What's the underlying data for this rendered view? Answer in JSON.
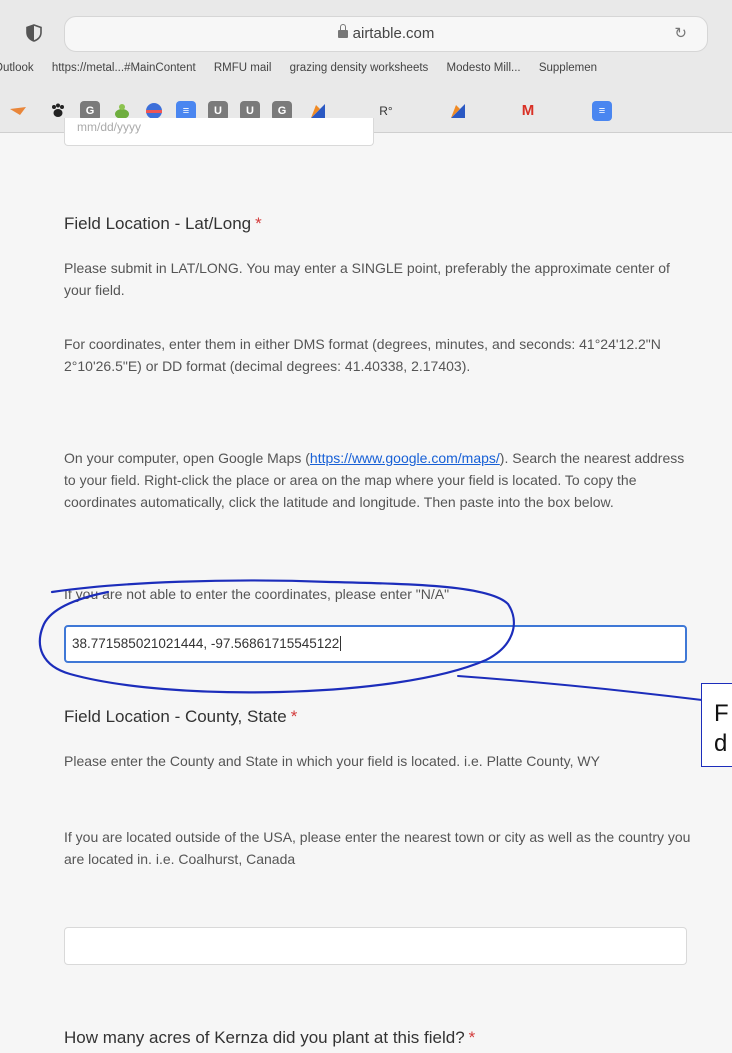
{
  "browser": {
    "url": "airtable.com",
    "bookmarks": [
      "Outlook",
      "https://metal...#MainContent",
      "RMFU mail",
      "grazing density worksheets",
      "Modesto Mill...",
      "Supplemen"
    ],
    "extensions": [
      {
        "name": "fox-icon",
        "glyph": "",
        "color": "#e9863a"
      },
      {
        "name": "paw-icon",
        "glyph": "🐾",
        "color": ""
      },
      {
        "name": "g-extension-icon",
        "glyph": "G",
        "color": "#7a7a7a"
      },
      {
        "name": "plant-icon",
        "glyph": "",
        "color": "#6fae3f"
      },
      {
        "name": "globe-icon",
        "glyph": "",
        "color": "#3d6fd9"
      },
      {
        "name": "docs-icon",
        "glyph": "≡",
        "color": "#4a86f0"
      },
      {
        "name": "u-extension-icon-1",
        "glyph": "U",
        "color": "#7a7a7a"
      },
      {
        "name": "u-extension-icon-2",
        "glyph": "U",
        "color": "#7a7a7a"
      },
      {
        "name": "g-extension-icon-2",
        "glyph": "G",
        "color": "#7a7a7a"
      },
      {
        "name": "colored-bookmark-icon-1",
        "glyph": "",
        "color": "#2b59c3"
      },
      {
        "name": "r-extension-icon",
        "glyph": "R°",
        "color": ""
      },
      {
        "name": "colored-bookmark-icon-2",
        "glyph": "",
        "color": "#2b59c3"
      },
      {
        "name": "gmail-icon",
        "glyph": "M",
        "color": ""
      },
      {
        "name": "docs-icon-2",
        "glyph": "≡",
        "color": "#4a86f0"
      }
    ]
  },
  "form": {
    "prev_field_placeholder": "mm/dd/yyyy",
    "lat_long": {
      "title": "Field Location - Lat/Long",
      "required_mark": "*",
      "para1": "Please submit in LAT/LONG. You may enter a SINGLE point, preferably the approximate center of your field.",
      "para2": "For coordinates, enter them in either DMS format (degrees, minutes, and seconds: 41°24'12.2\"N 2°10'26.5\"E) or DD format (decimal degrees: 41.40338, 2.17403).",
      "para3_before": "On your computer, open Google Maps (",
      "para3_link": "https://www.google.com/maps/",
      "para3_after": "). Search the nearest address to your field. Right-click the place or area on the map where your field is located. To copy the coordinates automatically, click the latitude and longitude. Then paste into the box below.",
      "para4": "If you are not able to enter the coordinates, please enter \"N/A\"",
      "value": "38.771585021021444, -97.56861715545122"
    },
    "county_state": {
      "title": "Field Location - County, State",
      "required_mark": "*",
      "para1": "Please enter the County and State in which your field is located. i.e. Platte County, WY",
      "para2": "If you are located outside of the USA, please enter the nearest town or city as well as the country you are located in. i.e. Coalhurst, Canada",
      "value": ""
    },
    "acres": {
      "title": "How many acres of Kernza did you plant at this field?",
      "required_mark": "*"
    }
  },
  "annotation": {
    "callout_line1": "F",
    "callout_line2": "d",
    "ink_color": "#1c2dbb"
  }
}
